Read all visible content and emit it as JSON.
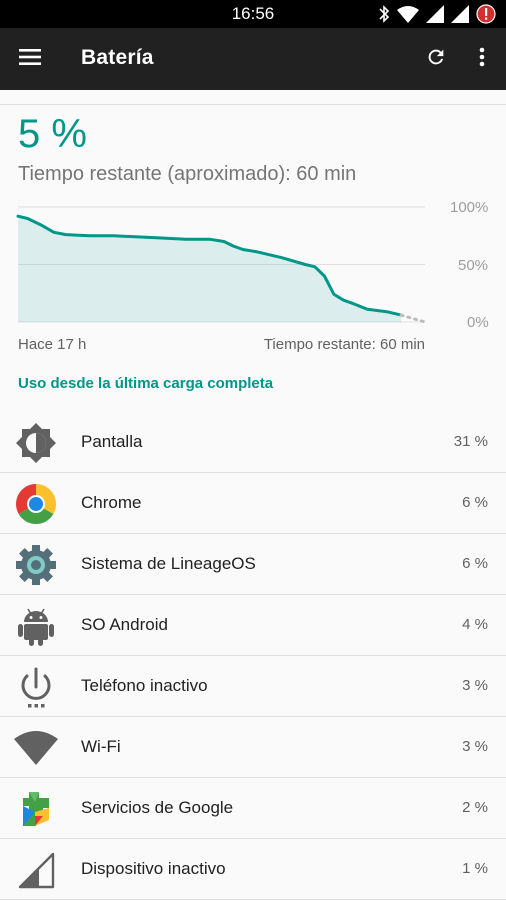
{
  "status_bar": {
    "time": "16:56",
    "icons": [
      "bluetooth-icon",
      "wifi-icon",
      "signal-icon",
      "signal-icon",
      "battery-alert-icon"
    ]
  },
  "app_bar": {
    "title": "Batería",
    "actions": [
      "refresh-icon",
      "more-vert-icon"
    ]
  },
  "battery": {
    "level": "5 %",
    "remaining": "Tiempo restante (aproximado): 60 min"
  },
  "chart_data": {
    "type": "area",
    "x": [
      0,
      0.4,
      1,
      1.5,
      2,
      3,
      4,
      5,
      6,
      7,
      8,
      8.6,
      9,
      9.4,
      10,
      11,
      12,
      12.4,
      12.8,
      13.2,
      13.6,
      14,
      14.6,
      15,
      15.4,
      15.6,
      16
    ],
    "values": [
      92,
      90,
      84,
      78,
      76,
      75,
      75,
      74,
      73,
      72,
      72,
      70,
      66,
      63,
      61,
      56,
      50,
      48,
      40,
      24,
      19,
      16,
      11,
      10,
      9,
      8,
      6
    ],
    "projection": {
      "x": [
        16,
        17
      ],
      "values": [
        6,
        0
      ]
    },
    "x_start_label": "Hace 17 h",
    "x_end_label": "Tiempo restante: 60 min",
    "y_ticks": [
      "100%",
      "50%",
      "0%"
    ],
    "ylim": [
      0,
      100
    ],
    "grid": true,
    "color": "#009688"
  },
  "usage": {
    "header": "Uso desde la última carga completa",
    "items": [
      {
        "name": "Pantalla",
        "percent": "31 %",
        "icon": "brightness-icon"
      },
      {
        "name": "Chrome",
        "percent": "6 %",
        "icon": "chrome-icon"
      },
      {
        "name": "Sistema de LineageOS",
        "percent": "6 %",
        "icon": "settings-gear-icon"
      },
      {
        "name": "SO Android",
        "percent": "4 %",
        "icon": "android-icon"
      },
      {
        "name": "Teléfono inactivo",
        "percent": "3 %",
        "icon": "power-icon"
      },
      {
        "name": "Wi-Fi",
        "percent": "3 %",
        "icon": "wifi-icon"
      },
      {
        "name": "Servicios de Google",
        "percent": "2 %",
        "icon": "google-play-services-icon"
      },
      {
        "name": "Dispositivo inactivo",
        "percent": "1 %",
        "icon": "cell-signal-icon"
      }
    ]
  }
}
